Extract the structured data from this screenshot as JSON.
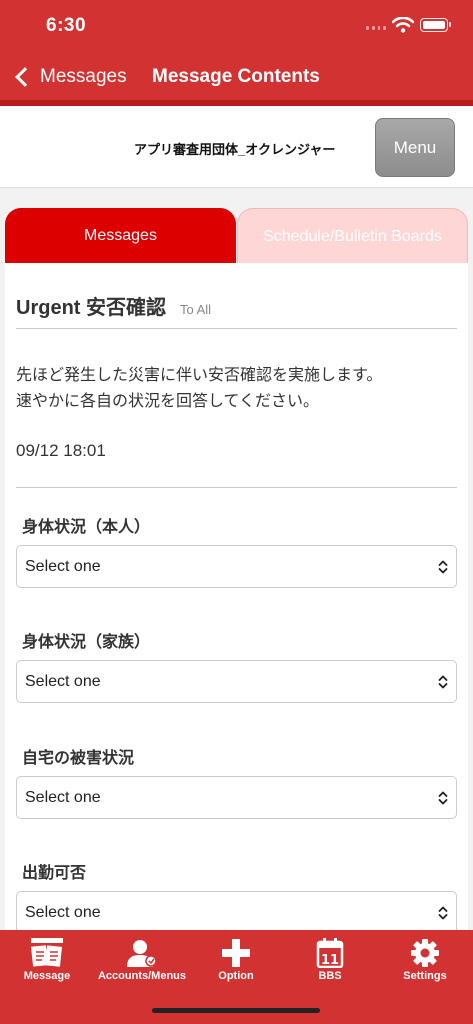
{
  "status": {
    "time": "6:30"
  },
  "nav": {
    "back_label": "Messages",
    "title": "Message Contents"
  },
  "org": {
    "name": "アプリ審査用団体_オクレンジャー",
    "menu_label": "Menu"
  },
  "tabs": [
    {
      "label": "Messages",
      "active": true
    },
    {
      "label": "Schedule/Bulletin Boards",
      "active": false
    }
  ],
  "message": {
    "title": "Urgent 安否確認",
    "to": "To All",
    "body_line1": "先ほど発生した災害に伴い安否確認を実施します。",
    "body_line2": "速やかに各自の状況を回答してください。",
    "date": "09/12 18:01"
  },
  "questions": [
    {
      "label": "身体状況（本人）",
      "value": "Select one"
    },
    {
      "label": "身体状況（家族）",
      "value": "Select one"
    },
    {
      "label": "自宅の被害状況",
      "value": "Select one"
    },
    {
      "label": "出勤可否",
      "value": "Select one"
    }
  ],
  "tabbar": {
    "items": [
      {
        "label": "Message",
        "icon": "message-icon"
      },
      {
        "label": "Accounts/Menus",
        "icon": "account-icon"
      },
      {
        "label": "Option",
        "icon": "plus-icon"
      },
      {
        "label": "BBS",
        "icon": "calendar-icon",
        "badge": "11"
      },
      {
        "label": "Settings",
        "icon": "gear-icon"
      }
    ]
  },
  "colors": {
    "brand_red": "#d23232",
    "tab_active": "#dd0000",
    "tab_inactive": "#ffd6d6"
  }
}
